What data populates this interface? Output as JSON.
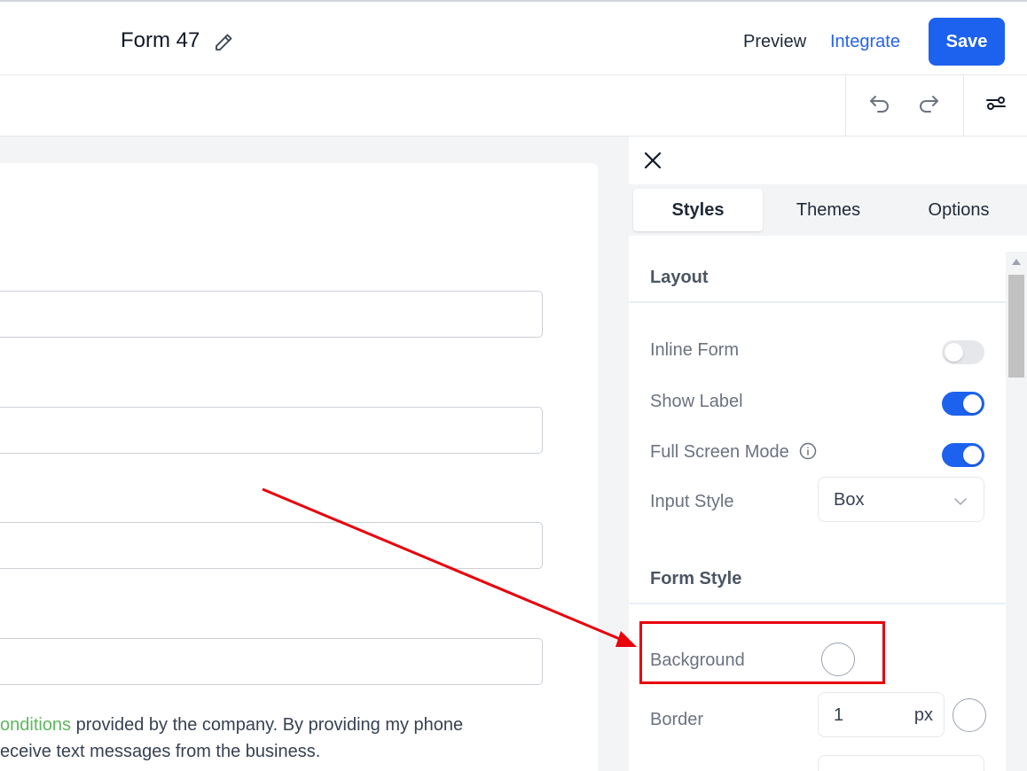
{
  "header": {
    "form_title": "Form 47",
    "preview_label": "Preview",
    "integrate_label": "Integrate",
    "save_label": "Save"
  },
  "toolbar": {
    "icons": [
      "undo-icon",
      "redo-icon",
      "settings-sliders-icon"
    ]
  },
  "canvas": {
    "consent_line1_link": "onditions",
    "consent_line1_rest": " provided by the company. By providing my phone",
    "consent_line2": "eceive text messages from the business."
  },
  "panel": {
    "tabs": [
      {
        "label": "Styles",
        "active": true
      },
      {
        "label": "Themes",
        "active": false
      },
      {
        "label": "Options",
        "active": false
      }
    ],
    "layout": {
      "heading": "Layout",
      "inline_form": {
        "label": "Inline Form",
        "on": false
      },
      "show_label": {
        "label": "Show Label",
        "on": true
      },
      "full_screen_mode": {
        "label": "Full Screen Mode",
        "on": true
      },
      "input_style": {
        "label": "Input Style",
        "value": "Box"
      }
    },
    "form_style": {
      "heading": "Form Style",
      "background": {
        "label": "Background"
      },
      "border": {
        "label": "Border",
        "value": "1",
        "unit": "px"
      }
    }
  },
  "colors": {
    "accent": "#1d62ee",
    "link_green": "#5cb85c",
    "annotation_red": "#e8000b"
  }
}
